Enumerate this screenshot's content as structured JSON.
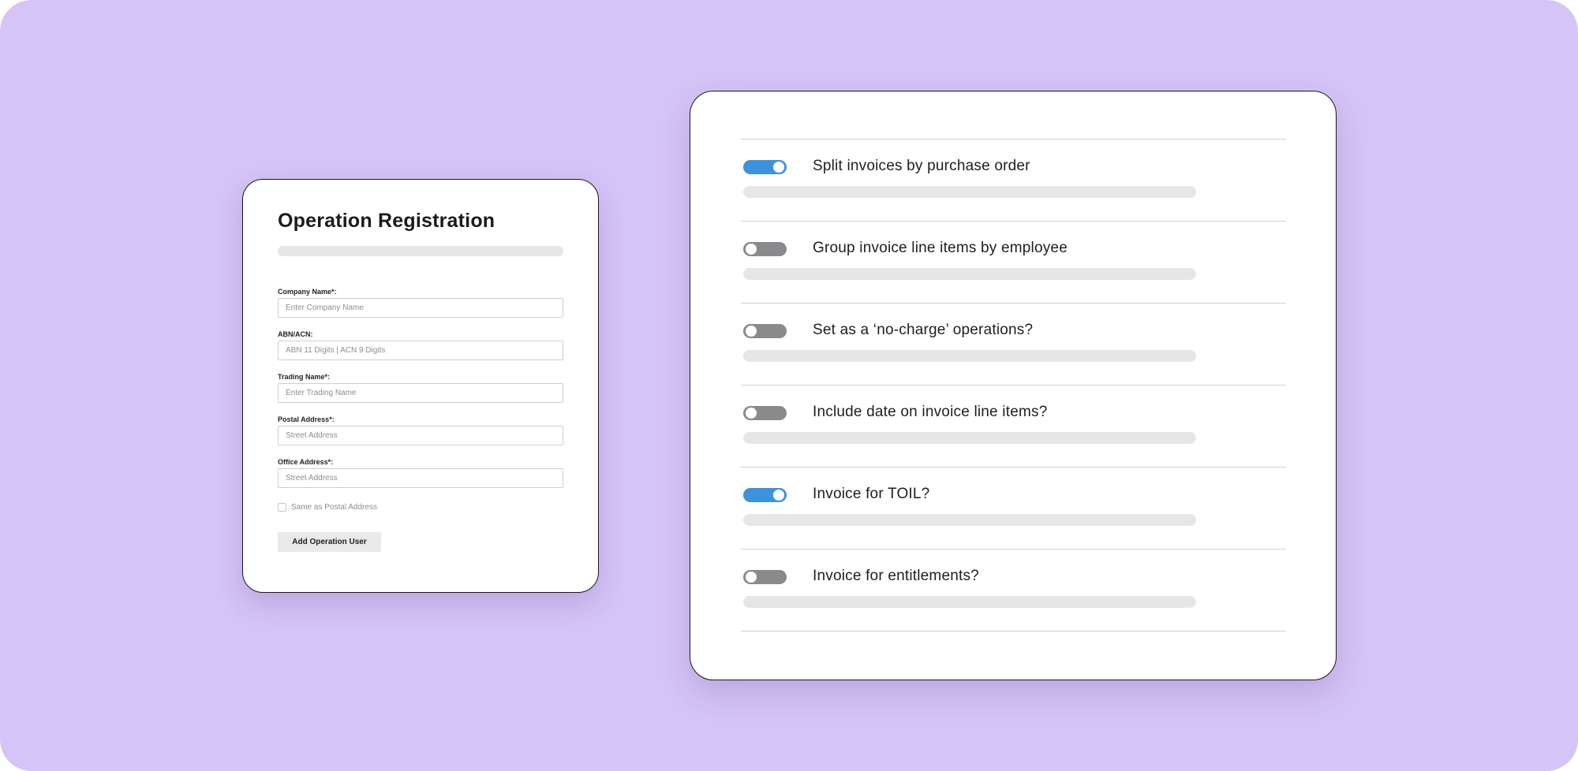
{
  "registration_form": {
    "title": "Operation Registration",
    "fields": [
      {
        "label": "Company Name*:",
        "placeholder": "Enter Company Name"
      },
      {
        "label": "ABN/ACN:",
        "placeholder": "ABN 11 Digits | ACN 9 Digits"
      },
      {
        "label": "Trading Name*:",
        "placeholder": "Enter Trading Name"
      },
      {
        "label": "Postal Address*:",
        "placeholder": "Street Address"
      },
      {
        "label": "Office Address*:",
        "placeholder": "Street Address"
      }
    ],
    "same_as_postal": {
      "label": "Same as Postal Address",
      "checked": false
    },
    "add_user_button": "Add Operation User"
  },
  "invoice_settings": {
    "items": [
      {
        "label": "Split invoices by purchase order",
        "enabled": true
      },
      {
        "label": "Group invoice line items by employee",
        "enabled": false
      },
      {
        "label": "Set as a ‘no-charge’ operations?",
        "enabled": false
      },
      {
        "label": "Include date on invoice line items?",
        "enabled": false
      },
      {
        "label": "Invoice for TOIL?",
        "enabled": true
      },
      {
        "label": "Invoice for entitlements?",
        "enabled": false
      }
    ]
  },
  "colors": {
    "background": "#d5c4f6",
    "toggle_on": "#3d92de",
    "toggle_off": "#8a8a8d",
    "placeholder_bar": "#e6e6e8"
  }
}
